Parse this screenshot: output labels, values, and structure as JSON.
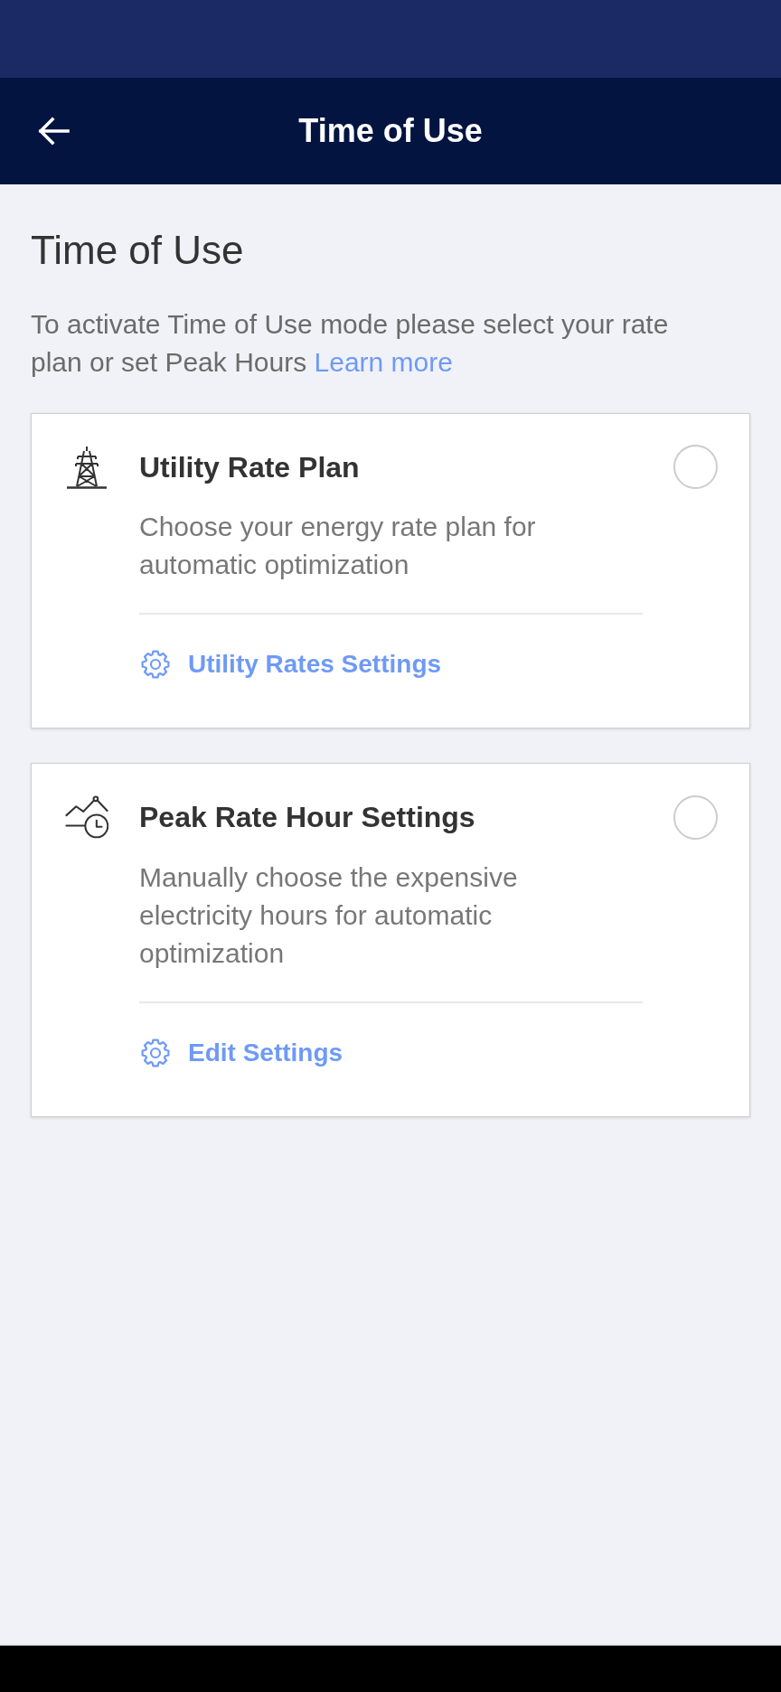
{
  "app_bar": {
    "title": "Time of Use"
  },
  "intro": {
    "heading": "Time of Use",
    "text": "To activate Time of Use mode please select your rate plan or set Peak Hours",
    "link": "Learn more"
  },
  "options": [
    {
      "kind": "rate_plan",
      "title": "Utility Rate Plan",
      "description": "Choose your energy rate plan for automatic optimization",
      "selected": false,
      "action": "Utility Rates Settings"
    },
    {
      "kind": "peak_hours",
      "title": "Peak Rate Hour Settings",
      "description": "Manually choose the expensive electricity hours for automatic optimization",
      "selected": false,
      "action": "Edit Settings"
    }
  ]
}
